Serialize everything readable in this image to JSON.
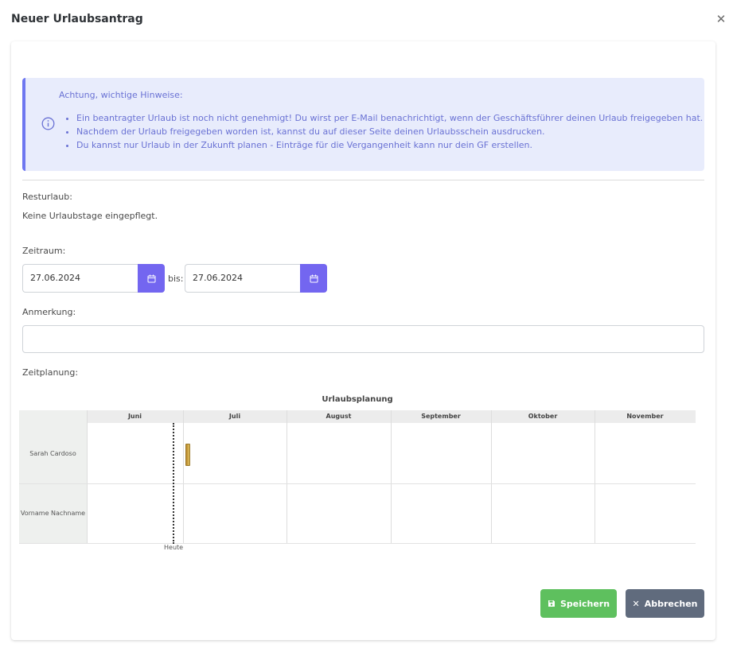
{
  "modal": {
    "title": "Neuer Urlaubsantrag",
    "close_icon": "close-icon"
  },
  "alert": {
    "heading": "Achtung, wichtige Hinweise:",
    "icon": "info-icon",
    "items": [
      "Ein beantragter Urlaub ist noch nicht genehmigt! Du wirst per E-Mail benachrichtigt, wenn der Geschäftsführer deinen Urlaub freigegeben hat.",
      "Nachdem der Urlaub freigegeben worden ist, kannst du auf dieser Seite deinen Urlaubsschein ausdrucken.",
      "Du kannst nur Urlaub in der Zukunft planen - Einträge für die Vergangenheit kann nur dein GF erstellen."
    ],
    "accent_color": "#6e77f0"
  },
  "form": {
    "resturlaub_label": "Resturlaub:",
    "resturlaub_value": "Keine Urlaubstage eingepflegt.",
    "zeitraum_label": "Zeitraum:",
    "date_from": "27.06.2024",
    "bis_label": "bis:",
    "date_to": "27.06.2024",
    "anmerkung_label": "Anmerkung:",
    "anmerkung_value": "",
    "zeitplanung_label": "Zeitplanung:"
  },
  "timeline": {
    "title": "Urlaubsplanung",
    "months": [
      "Juni",
      "Juli",
      "August",
      "September",
      "Oktober",
      "November"
    ],
    "rows": [
      "Sarah Cardoso",
      "Vorname Nachname"
    ],
    "today_label": "Heute"
  },
  "buttons": {
    "save": "Speichern",
    "cancel": "Abbrechen"
  },
  "colors": {
    "primary": "#7366f0",
    "success": "#5ec05e",
    "secondary": "#606b7d"
  }
}
